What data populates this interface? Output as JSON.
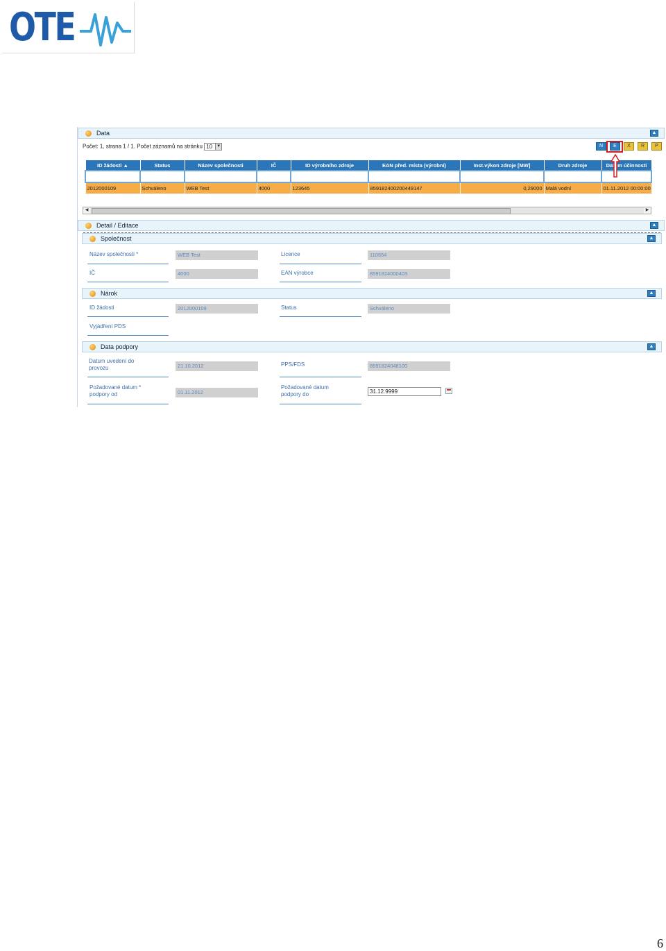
{
  "logo": {
    "text": "OTE"
  },
  "data_panel": {
    "title": "Data",
    "pager_text": "Počet: 1, strana 1 / 1. Počet záznamů na stránku",
    "page_size": "10",
    "columns": [
      "ID žádosti ▲",
      "Status",
      "Název společnosti",
      "IČ",
      "ID výrobního zdroje",
      "EAN před. místa (výrobní)",
      "Inst.výkon zdroje [MW]",
      "Druh zdroje",
      "Datum účinnosti"
    ],
    "rows": [
      [
        "2012000109",
        "Schváleno",
        "WEB Test",
        "4000",
        "123645",
        "859182400200449147",
        "0,29000",
        "Malá vodní",
        "01.11.2012 00:00:00"
      ]
    ]
  },
  "detail": {
    "title": "Detail / Editace",
    "spolecnost": {
      "title": "Společnost",
      "nazev_label": "Název společnosti *",
      "nazev_value": "WEB Test",
      "licence_label": "Licence",
      "licence_value": "110654",
      "ic_label": "IČ",
      "ic_value": "4000",
      "ean_label": "EAN výrobce",
      "ean_value": "8591824000403"
    },
    "narok": {
      "title": "Nárok",
      "id_label": "ID žádosti",
      "id_value": "2012000109",
      "status_label": "Status",
      "status_value": "Schváleno",
      "vyjadreni_label": "Vyjádření PDS"
    },
    "podpora": {
      "title": "Data podpory",
      "datum_uvedeni_label_1": "Datum uvedení do",
      "datum_uvedeni_label_2": "provozu",
      "datum_uvedeni_value": "21.10.2012",
      "pps_label": "PPS/FDS",
      "pps_value": "8591824048100",
      "od_label_1": "Požadované datum",
      "od_label_2": "podpory od",
      "od_value": "01.11.2012",
      "do_label_1": "Požadované datum",
      "do_label_2": "podpory do",
      "do_value": "31.12.9999"
    }
  },
  "page_number": "6"
}
